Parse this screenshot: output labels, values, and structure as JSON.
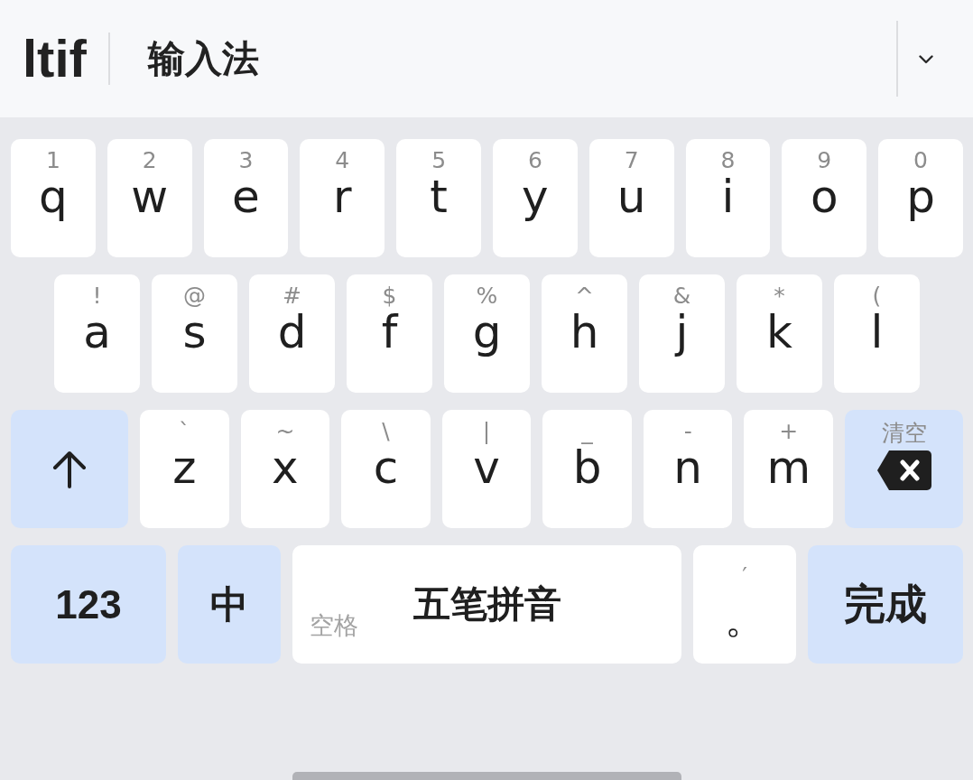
{
  "toolbar": {
    "logo": "ltif",
    "title": "输入法"
  },
  "rows": [
    [
      {
        "kind": "letter",
        "hint": "1",
        "label": "q"
      },
      {
        "kind": "letter",
        "hint": "2",
        "label": "w"
      },
      {
        "kind": "letter",
        "hint": "3",
        "label": "e"
      },
      {
        "kind": "letter",
        "hint": "4",
        "label": "r"
      },
      {
        "kind": "letter",
        "hint": "5",
        "label": "t"
      },
      {
        "kind": "letter",
        "hint": "6",
        "label": "y"
      },
      {
        "kind": "letter",
        "hint": "7",
        "label": "u"
      },
      {
        "kind": "letter",
        "hint": "8",
        "label": "i"
      },
      {
        "kind": "letter",
        "hint": "9",
        "label": "o"
      },
      {
        "kind": "letter",
        "hint": "0",
        "label": "p"
      }
    ],
    [
      {
        "kind": "letter",
        "hint": "!",
        "label": "a"
      },
      {
        "kind": "letter",
        "hint": "@",
        "label": "s"
      },
      {
        "kind": "letter",
        "hint": "#",
        "label": "d"
      },
      {
        "kind": "letter",
        "hint": "$",
        "label": "f"
      },
      {
        "kind": "letter",
        "hint": "%",
        "label": "g"
      },
      {
        "kind": "letter",
        "hint": "^",
        "label": "h"
      },
      {
        "kind": "letter",
        "hint": "&",
        "label": "j"
      },
      {
        "kind": "letter",
        "hint": "*",
        "label": "k"
      },
      {
        "kind": "letter",
        "hint": "(",
        "label": "l"
      }
    ],
    [
      {
        "kind": "shift"
      },
      {
        "kind": "letter",
        "hint": "`",
        "label": "z"
      },
      {
        "kind": "letter",
        "hint": "~",
        "label": "x"
      },
      {
        "kind": "letter",
        "hint": "\\",
        "label": "c"
      },
      {
        "kind": "letter",
        "hint": "|",
        "label": "v"
      },
      {
        "kind": "letter",
        "hint": "_",
        "label": "b"
      },
      {
        "kind": "letter",
        "hint": "-",
        "label": "n"
      },
      {
        "kind": "letter",
        "hint": "+",
        "label": "m"
      },
      {
        "kind": "backspace",
        "hint": "清空"
      }
    ],
    [
      {
        "kind": "symbols",
        "label": "123"
      },
      {
        "kind": "language",
        "label": "中"
      },
      {
        "kind": "space",
        "hint": "空格",
        "label": "五笔拼音"
      },
      {
        "kind": "punctuation",
        "hint": "′",
        "label": "。"
      },
      {
        "kind": "done",
        "label": "完成"
      }
    ]
  ]
}
